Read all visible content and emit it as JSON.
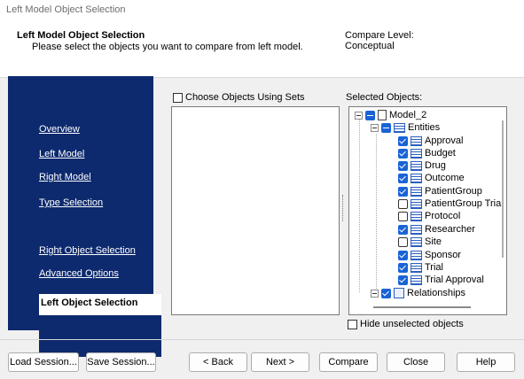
{
  "window": {
    "title": "Left Model Object Selection"
  },
  "header": {
    "title": "Left Model Object Selection",
    "subtitle": "Please select the objects you want to compare from left model.",
    "compare_level_label": "Compare Level:",
    "compare_level_value": "Conceptual"
  },
  "nav": {
    "items": [
      {
        "label": "Overview"
      },
      {
        "label": "Left Model"
      },
      {
        "label": "Right Model"
      },
      {
        "label": "Type Selection"
      },
      {
        "label": "Left Object Selection",
        "active": true
      },
      {
        "label": "Right Object Selection"
      },
      {
        "label": "Advanced Options"
      }
    ]
  },
  "left_panel": {
    "choose_sets_label": "Choose Objects Using Sets",
    "choose_sets_checked": false
  },
  "right_panel": {
    "label": "Selected Objects:",
    "hide_unselected_label": "Hide unselected objects",
    "hide_unselected_checked": false,
    "tree": {
      "model": "Model_2",
      "entities_label": "Entities",
      "entities": [
        {
          "name": "Approval",
          "checked": true
        },
        {
          "name": "Budget",
          "checked": true
        },
        {
          "name": "Drug",
          "checked": true
        },
        {
          "name": "Outcome",
          "checked": true
        },
        {
          "name": "PatientGroup",
          "checked": true
        },
        {
          "name": "PatientGroup Tria",
          "checked": false
        },
        {
          "name": "Protocol",
          "checked": false
        },
        {
          "name": "Researcher",
          "checked": true
        },
        {
          "name": "Site",
          "checked": false
        },
        {
          "name": "Sponsor",
          "checked": true
        },
        {
          "name": "Trial",
          "checked": true
        },
        {
          "name": "Trial Approval",
          "checked": true
        }
      ],
      "relationships_label": "Relationships"
    }
  },
  "buttons": {
    "load_session": "Load Session...",
    "save_session": "Save Session...",
    "back": "< Back",
    "next": "Next >",
    "compare": "Compare",
    "close": "Close",
    "help": "Help"
  },
  "colors": {
    "nav_bg": "#0d2a6e",
    "checkbox_blue": "#1a63d6"
  }
}
